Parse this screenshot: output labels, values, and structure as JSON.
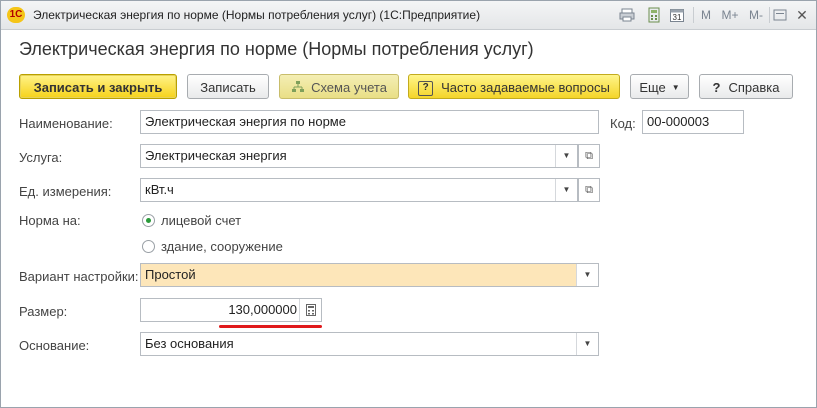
{
  "window": {
    "title": "Электрическая энергия по норме (Нормы потребления услуг)  (1С:Предприятие)",
    "logo_text": "1С",
    "toolbar_icons": [
      "print-icon",
      "calculator-icon",
      "calendar-icon"
    ],
    "calendar_day": "31",
    "memory_buttons": [
      "M",
      "M+",
      "M-"
    ]
  },
  "form": {
    "title": "Электрическая энергия по норме (Нормы потребления услуг)"
  },
  "buttons": {
    "save_close": "Записать и закрыть",
    "save": "Записать",
    "scheme": "Схема учета",
    "faq": "Часто задаваемые вопросы",
    "more": "Еще",
    "help": "Справка"
  },
  "fields": {
    "name_label": "Наименование:",
    "name_value": "Электрическая энергия по норме",
    "code_label": "Код:",
    "code_value": "00-000003",
    "service_label": "Услуга:",
    "service_value": "Электрическая энергия",
    "unit_label": "Ед. измерения:",
    "unit_value": "кВт.ч",
    "norm_label": "Норма на:",
    "norm_options": [
      "лицевой счет",
      "здание, сооружение"
    ],
    "norm_selected": 0,
    "variant_label": "Вариант настройки:",
    "variant_value": "Простой",
    "size_label": "Размер:",
    "size_value": "130,000000",
    "basis_label": "Основание:",
    "basis_value": "Без основания"
  },
  "colors": {
    "primary_button": "#f6d21a",
    "highlight_field": "#fde6b9",
    "radio_checked": "#2a9a3a",
    "annotation_underline": "#e0191c"
  }
}
